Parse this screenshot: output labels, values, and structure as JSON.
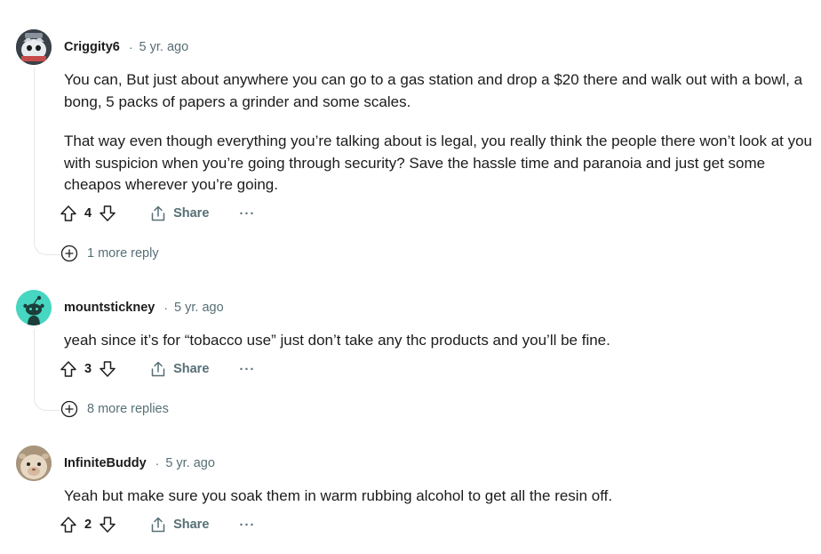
{
  "comments": [
    {
      "username": "Criggity6",
      "separator": "·",
      "time": "5 yr. ago",
      "paragraphs": [
        "You can, But just about anywhere you can go to a gas station and drop a $20 there and walk out with a bowl, a bong, 5 packs of papers a grinder and some scales.",
        "That way even though everything you’re talking about is legal, you really think the people there won’t look at you with suspicion when you’re going through security? Save the hassle time and paranoia and just get some cheapos wherever you’re going."
      ],
      "votes": "4",
      "share_label": "Share",
      "more_label": "···",
      "replies_label": "1 more reply",
      "avatar_icon": "snoo-avatar-icon"
    },
    {
      "username": "mountstickney",
      "separator": "·",
      "time": "5 yr. ago",
      "paragraphs": [
        "yeah since it’s for “tobacco use” just don’t take any thc products and you’ll be fine."
      ],
      "votes": "3",
      "share_label": "Share",
      "more_label": "···",
      "replies_label": "8 more replies",
      "avatar_icon": "default-snoo-avatar-icon"
    },
    {
      "username": "InfiniteBuddy",
      "separator": "·",
      "time": "5 yr. ago",
      "paragraphs": [
        "Yeah but make sure you soak them in warm rubbing alcohol to get all the resin off."
      ],
      "votes": "2",
      "share_label": "Share",
      "more_label": "···",
      "avatar_icon": "photo-avatar-icon"
    }
  ],
  "colors": {
    "text": "#1c1c1c",
    "meta": "#576f76",
    "thread_line": "#e3e6e8",
    "snoo_teal": "#46d6c1"
  }
}
